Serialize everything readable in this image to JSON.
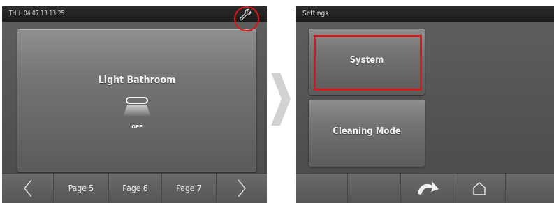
{
  "left_screen": {
    "status": {
      "datetime": "THU. 04.07.13  13:25"
    },
    "tile": {
      "title": "Light Bathroom",
      "state": "OFF"
    },
    "nav": {
      "pages": [
        "Page 5",
        "Page 6",
        "Page 7"
      ]
    }
  },
  "right_screen": {
    "title": "Settings",
    "tiles": [
      {
        "label": "System"
      },
      {
        "label": "Cleaning Mode"
      }
    ]
  },
  "colors": {
    "highlight": "#e01515",
    "screen_bg": "#555555"
  },
  "icons": [
    "wrench-icon",
    "lamp-icon",
    "arrow-left-icon",
    "arrow-right-icon",
    "back-icon",
    "home-icon"
  ]
}
